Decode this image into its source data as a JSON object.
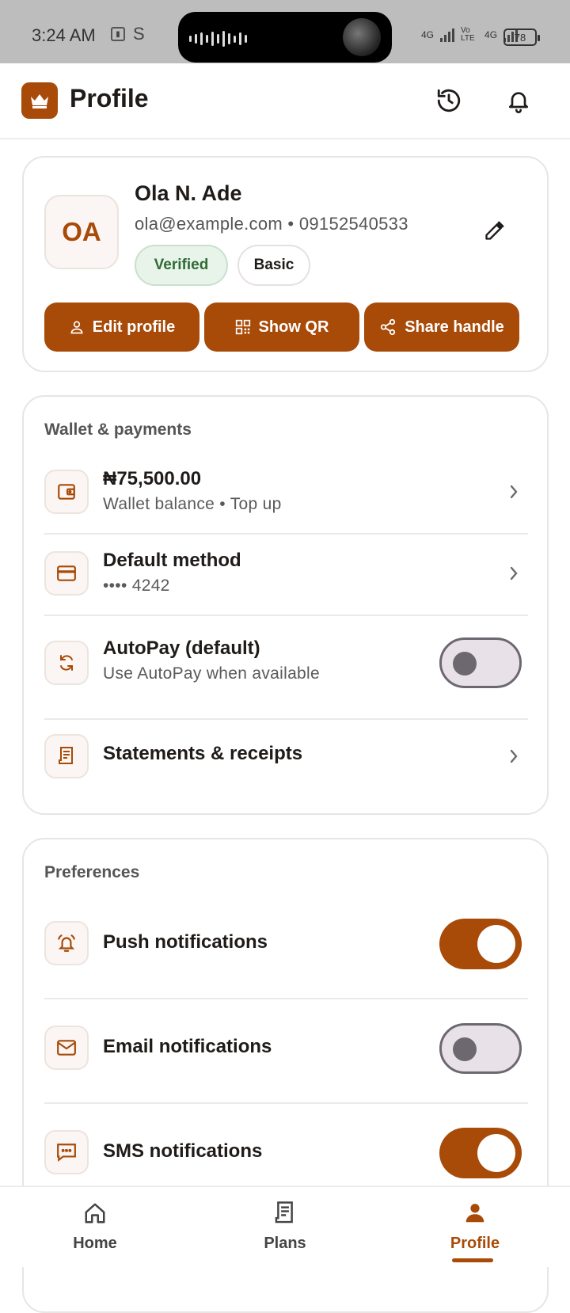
{
  "status_bar": {
    "time": "3:24 AM",
    "carrier_icon": "S",
    "net1": "4G",
    "net2": "Vo LTE",
    "net3": "4G",
    "battery": "78"
  },
  "header": {
    "title": "Profile",
    "logo_icon": "crown-icon",
    "history_icon": "history-icon",
    "bell_icon": "bell-icon"
  },
  "profile": {
    "initials": "OA",
    "name": "Ola N. Ade",
    "contact": "ola@example.com • 09152540533",
    "badge_verified": "Verified",
    "badge_plan": "Basic",
    "actions": {
      "edit": "Edit profile",
      "qr": "Show QR",
      "share": "Share handle"
    }
  },
  "wallet": {
    "section_title": "Wallet & payments",
    "balance": "₦75,500.00",
    "balance_sub": "Wallet balance • Top up",
    "method_title": "Default method",
    "method_sub": "•••• 4242",
    "autopay_title": "AutoPay (default)",
    "autopay_sub": "Use AutoPay when available",
    "autopay_on": false,
    "statements_title": "Statements & receipts"
  },
  "preferences": {
    "section_title": "Preferences",
    "push_title": "Push notifications",
    "push_on": true,
    "email_title": "Email notifications",
    "email_on": false,
    "sms_title": "SMS notifications",
    "sms_on": true
  },
  "bottom_nav": {
    "home": "Home",
    "plans": "Plans",
    "profile": "Profile",
    "active": "profile"
  },
  "colors": {
    "accent": "#a84a08",
    "verified_text": "#2f6b35"
  }
}
